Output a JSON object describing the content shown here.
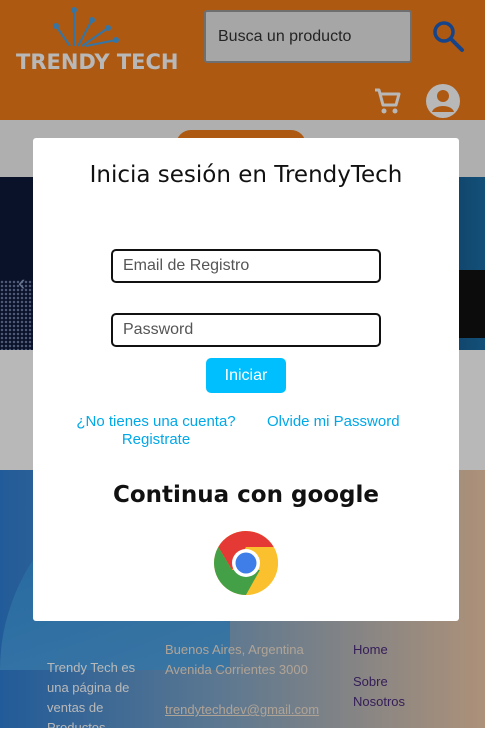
{
  "header": {
    "logo_text": "TRENDY TECH",
    "search_placeholder": "Busca un producto",
    "icons": {
      "search": "search-icon",
      "cart": "cart-icon",
      "account": "account-icon"
    },
    "colors": {
      "brand": "#f07c1a",
      "accent_blue": "#1f5fbf"
    }
  },
  "footer": {
    "about": "Trendy Tech es una página de ventas de Productos",
    "address_line1": "Buenos Aires, Argentina",
    "address_line2": "Avenida Corrientes 3000",
    "email": "trendytechdev@gmail.com",
    "links": [
      "Home",
      "Sobre Nosotros"
    ]
  },
  "login_modal": {
    "title": "Inicia sesión en TrendyTech",
    "email_placeholder": "Email de Registro",
    "password_placeholder": "Password",
    "submit_label": "Iniciar",
    "register_link_line1": "¿No tienes una cuenta?",
    "register_link_line2": "Registrate",
    "forgot_link": "Olvide mi Password",
    "google_title": "Continua con google",
    "google_icon": "chrome-icon",
    "colors": {
      "link": "#00a8e8",
      "button": "#00bfff"
    }
  }
}
